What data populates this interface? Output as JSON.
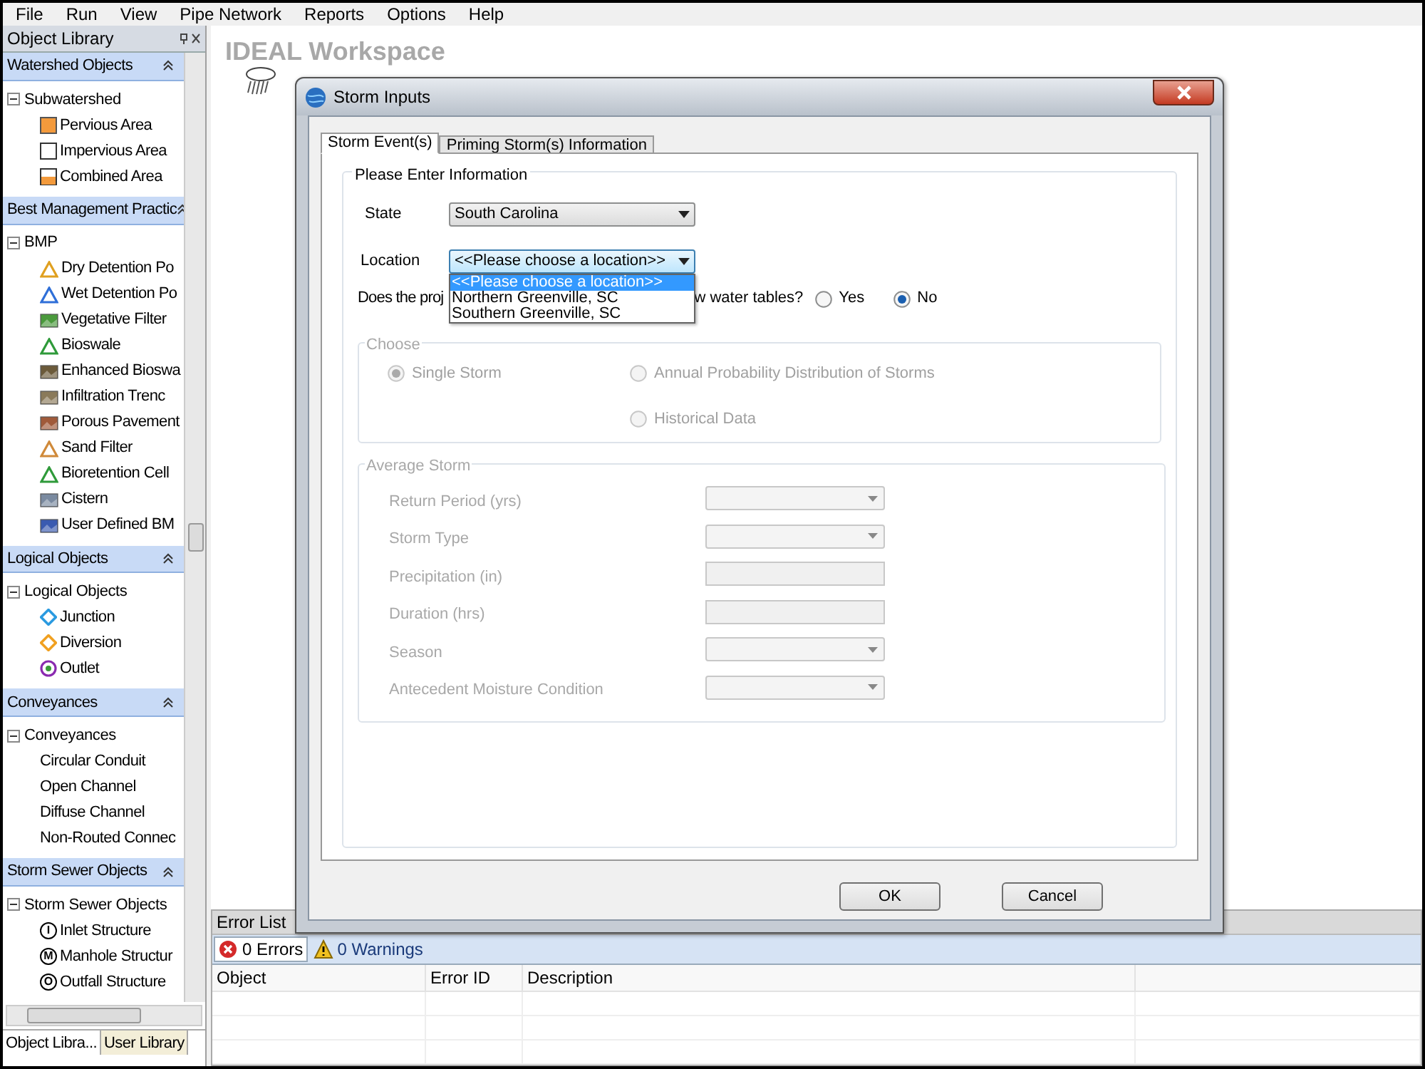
{
  "menu": [
    "File",
    "Run",
    "View",
    "Pipe Network",
    "Reports",
    "Options",
    "Help"
  ],
  "library": {
    "title": "Object Library",
    "sections": [
      {
        "title": "Watershed Objects",
        "expanded": true,
        "tree": {
          "label": "Subwatershed",
          "expanded": true,
          "children": [
            {
              "label": "Pervious Area",
              "kind": "square",
              "color": "#f39a3c"
            },
            {
              "label": "Impervious Area",
              "kind": "outline"
            },
            {
              "label": "Combined Area",
              "kind": "half",
              "color": "#f39a3c"
            }
          ]
        }
      },
      {
        "title": "Best Management Practic",
        "expanded": true,
        "tree": {
          "label": "BMP",
          "expanded": true,
          "children": [
            {
              "label": "Dry Detention Po",
              "kind": "triangle",
              "color": "#e0a020"
            },
            {
              "label": "Wet Detention Po",
              "kind": "triangle",
              "color": "#2f6fd8"
            },
            {
              "label": "Vegetative Filter",
              "kind": "tile",
              "color": "#4a9a3c"
            },
            {
              "label": "Bioswale",
              "kind": "triangle",
              "color": "#2f9a3a"
            },
            {
              "label": "Enhanced Bioswa",
              "kind": "tile",
              "color": "#6b5a3a"
            },
            {
              "label": "Infiltration Trenc",
              "kind": "tile",
              "color": "#8a7a5a"
            },
            {
              "label": "Porous Pavement",
              "kind": "tile",
              "color": "#a05a3a"
            },
            {
              "label": "Sand Filter",
              "kind": "triangle",
              "color": "#d08a3a"
            },
            {
              "label": "Bioretention Cell",
              "kind": "triangle",
              "color": "#2f9a3a"
            },
            {
              "label": "Cistern",
              "kind": "tile",
              "color": "#7a8aa0"
            },
            {
              "label": "User Defined BM",
              "kind": "tile",
              "color": "#3a5ab0"
            }
          ]
        }
      },
      {
        "title": "Logical Objects",
        "expanded": true,
        "tree": {
          "label": "Logical Objects",
          "expanded": true,
          "children": [
            {
              "label": "Junction",
              "kind": "diamond",
              "color": "#2a9ae0"
            },
            {
              "label": "Diversion",
              "kind": "diamond",
              "color": "#f0a020"
            },
            {
              "label": "Outlet",
              "kind": "ring",
              "color": "#8a2ab0"
            }
          ]
        }
      },
      {
        "title": "Conveyances",
        "expanded": true,
        "tree": {
          "label": "Conveyances",
          "expanded": true,
          "children": [
            {
              "label": "Circular Conduit",
              "kind": "plain"
            },
            {
              "label": "Open Channel",
              "kind": "plain"
            },
            {
              "label": "Diffuse Channel",
              "kind": "plain"
            },
            {
              "label": "Non-Routed Connec",
              "kind": "plain"
            }
          ]
        }
      },
      {
        "title": "Storm Sewer Objects",
        "expanded": true,
        "tree": {
          "label": "Storm Sewer Objects",
          "expanded": true,
          "children": [
            {
              "label": "Inlet Structure",
              "kind": "lettered",
              "letter": "I"
            },
            {
              "label": "Manhole Structur",
              "kind": "lettered",
              "letter": "M"
            },
            {
              "label": "Outfall Structure",
              "kind": "lettered",
              "letter": "O"
            }
          ]
        }
      }
    ]
  },
  "library_tabs": [
    {
      "label": "Object Libra...",
      "selected": true
    },
    {
      "label": "User Library",
      "selected": false
    }
  ],
  "workspace": {
    "title": "IDEAL Workspace"
  },
  "dialog": {
    "title": "Storm Inputs",
    "tabs": [
      {
        "label": "Storm Event(s)",
        "selected": true
      },
      {
        "label": "Priming Storm(s) Information",
        "selected": false
      }
    ],
    "group_title": "Please Enter Information",
    "state": {
      "label": "State",
      "value": "South Carolina",
      "open": false
    },
    "location": {
      "label": "Location",
      "value": "<<Please choose a location>>",
      "open": true,
      "options": [
        {
          "label": "<<Please choose a location>>",
          "selected": true
        },
        {
          "label": "Northern Greenville, SC",
          "selected": false
        },
        {
          "label": "Southern Greenville, SC",
          "selected": false
        }
      ]
    },
    "question": {
      "start": "Does the proj",
      "end": "w water tables?",
      "options": [
        {
          "label": "Yes",
          "selected": false
        },
        {
          "label": "No",
          "selected": true
        }
      ]
    },
    "choose": {
      "title": "Choose",
      "disabled": true,
      "options": [
        {
          "label": "Single Storm",
          "selected": true
        },
        {
          "label": "Annual Probability Distribution of Storms",
          "selected": false
        },
        {
          "label": "Historical Data",
          "selected": false
        }
      ]
    },
    "average_storm": {
      "title": "Average Storm",
      "disabled": true,
      "fields": [
        {
          "label": "Return Period (yrs)",
          "kind": "select"
        },
        {
          "label": "Storm Type",
          "kind": "select"
        },
        {
          "label": "Precipitation (in)",
          "kind": "text"
        },
        {
          "label": "Duration (hrs)",
          "kind": "text"
        },
        {
          "label": "Season",
          "kind": "select"
        },
        {
          "label": "Antecedent Moisture Condition",
          "kind": "select"
        }
      ]
    },
    "buttons": [
      "OK",
      "Cancel"
    ]
  },
  "error_list": {
    "title": "Error List",
    "tabs": [
      {
        "label": "0 Errors",
        "kind": "error",
        "selected": true
      },
      {
        "label": "0 Warnings",
        "kind": "warning",
        "selected": false
      }
    ],
    "columns": [
      "Object",
      "Error ID",
      "Description"
    ]
  }
}
